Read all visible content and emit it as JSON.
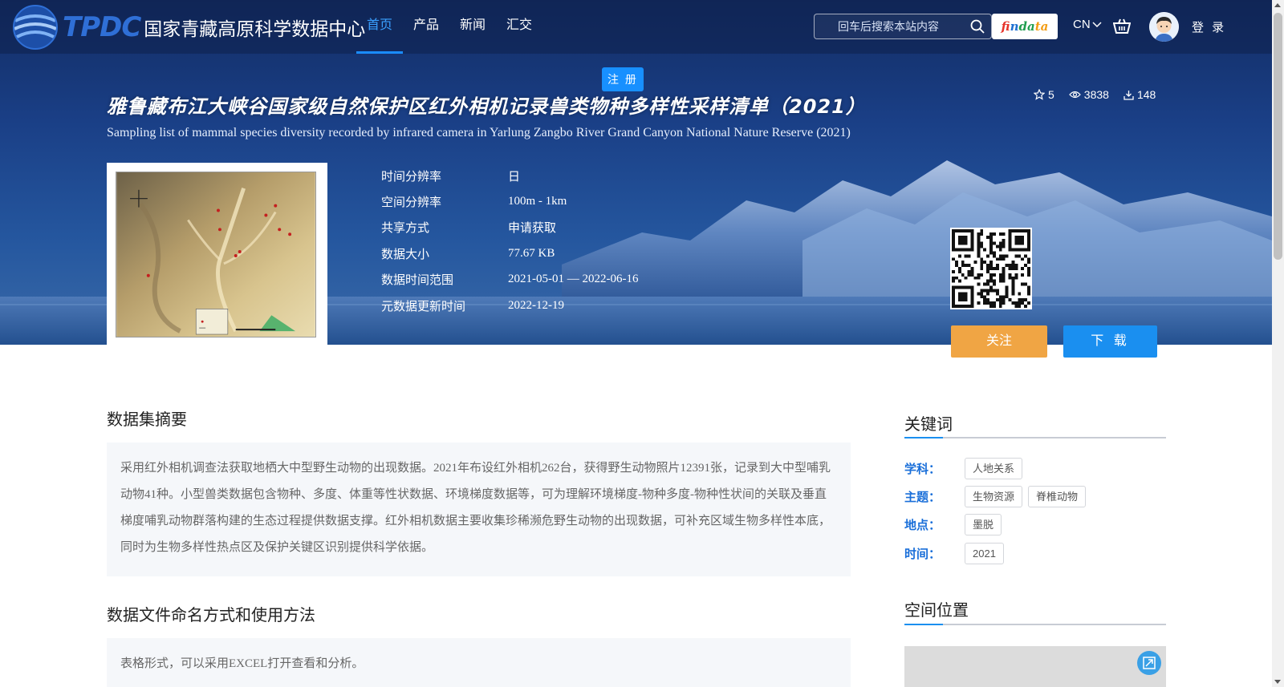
{
  "brand": {
    "logo_text": "TPDC",
    "name_cn": "国家青藏高原科学数据中心"
  },
  "nav": {
    "items": [
      "首页",
      "产品",
      "新闻",
      "汇交"
    ],
    "active": "首页"
  },
  "search": {
    "placeholder": "回车后搜索本站内容",
    "value": ""
  },
  "partner": {
    "findata_parts": [
      "f",
      "in",
      "da",
      "ta"
    ]
  },
  "lang": "CN",
  "user": {
    "login_label": "登 录",
    "register_label": "注 册"
  },
  "dataset": {
    "title_cn": "雅鲁藏布江大峡谷国家级自然保护区红外相机记录兽类物种多样性采样清单（2021）",
    "title_en": "Sampling list of mammal species diversity recorded by infrared camera in Yarlung Zangbo River Grand Canyon National Nature Reserve (2021)",
    "stats": {
      "stars": "5",
      "views": "3838",
      "downloads": "148"
    },
    "meta": [
      {
        "label": "时间分辨率",
        "value": "日"
      },
      {
        "label": "空间分辨率",
        "value": "100m - 1km"
      },
      {
        "label": "共享方式",
        "value": "申请获取"
      },
      {
        "label": "数据大小",
        "value": "77.67 KB"
      },
      {
        "label": "数据时间范围",
        "value": "2021-05-01 — 2022-06-16"
      },
      {
        "label": "元数据更新时间",
        "value": "2022-12-19"
      }
    ],
    "follow_label": "关注",
    "download_label": "下 载"
  },
  "sections": {
    "abstract_title": "数据集摘要",
    "abstract_text": "采用红外相机调查法获取地栖大中型野生动物的出现数据。2021年布设红外相机262台，获得野生动物照片12391张，记录到大中型哺乳动物41种。小型兽类数据包含物种、多度、体重等性状数据、环境梯度数据等，可为理解环境梯度-物种多度-物种性状间的关联及垂直梯度哺乳动物群落构建的生态过程提供数据支撑。红外相机数据主要收集珍稀濒危野生动物的出现数据，可补充区域生物多样性本底，同时为生物多样性热点区及保护关键区识别提供科学依据。",
    "naming_title": "数据文件命名方式和使用方法",
    "naming_text": "表格形式，可以采用EXCEL打开查看和分析。"
  },
  "sidebar": {
    "keywords_title": "关键词",
    "keywords": [
      {
        "label": "学科：",
        "tags": [
          "人地关系"
        ]
      },
      {
        "label": "主题：",
        "tags": [
          "生物资源",
          "脊椎动物"
        ]
      },
      {
        "label": "地点：",
        "tags": [
          "墨脱"
        ]
      },
      {
        "label": "时间：",
        "tags": [
          "2021"
        ]
      }
    ],
    "location_title": "空间位置"
  },
  "colors": {
    "accent": "#1a8ff0",
    "follow": "#f0a544",
    "keyword_label": "#1a6fd9"
  }
}
